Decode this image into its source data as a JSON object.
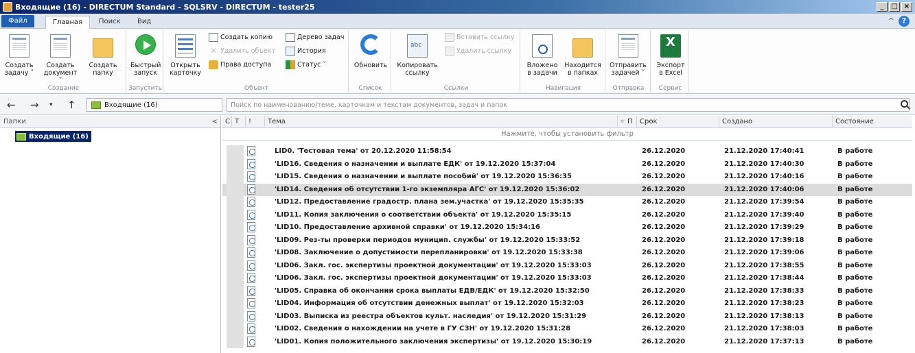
{
  "window": {
    "title": "Входящие (16) - DIRECTUM Standard - SQLSRV - DIRECTUM - tester25"
  },
  "tabs": {
    "file": "Файл",
    "home": "Главная",
    "search": "Поиск",
    "view": "Вид"
  },
  "ribbon": {
    "create": {
      "label": "Создание",
      "task": "Создать\nзадачу ˅",
      "document": "Создать\nдокумент ˅",
      "folder": "Создать\nпапку"
    },
    "run": {
      "label": "Запустить",
      "quick": "Быстрый\nзапуск"
    },
    "object": {
      "label": "Объект",
      "open_card": "Открыть\nкарточку",
      "create_copy": "Создать копию",
      "delete_object": "Удалить объект",
      "access_rights": "Права доступа",
      "task_tree": "Дерево задач",
      "history": "История",
      "status": "Статус ˅"
    },
    "list": {
      "label": "Список",
      "refresh": "Обновить"
    },
    "links": {
      "label": "Ссылки",
      "copy_link": "Копировать\nссылку",
      "paste_link": "Вставить ссылку",
      "delete_link": "Удалить ссылку"
    },
    "navigation": {
      "label": "Навигация",
      "nested": "Вложено\nв задачи",
      "located": "Находится\nв папках"
    },
    "send": {
      "label": "Отправка",
      "send_task": "Отправить\nзадачей ˅"
    },
    "service": {
      "label": "Сервис",
      "export_excel": "Экспорт\nв Excel"
    }
  },
  "address": {
    "crumb": "Входящие (16)",
    "search_placeholder": "Поиск по наименованию/теме, карточкам и текстам документов, задач и папок"
  },
  "folders": {
    "header": "Папки",
    "selected": "Входящие (16)"
  },
  "grid": {
    "columns": {
      "c": "С",
      "t": "Т",
      "imp": "!",
      "topic": "Тема",
      "p": "П",
      "due": "Срок",
      "created": "Создано",
      "state": "Состояние"
    },
    "filter_hint": "Нажмите, чтобы установить фильтр",
    "rows": [
      {
        "topic": "LID0. 'Тестовая тема' от 20.12.2020 11:58:54",
        "due": "26.12.2020",
        "created": "21.12.2020 17:40:41",
        "state": "В работе",
        "selected": false
      },
      {
        "topic": "'LID16. Сведения о назначении и выплате ЕДК' от 19.12.2020 15:37:04",
        "due": "26.12.2020",
        "created": "21.12.2020 17:40:30",
        "state": "В работе",
        "selected": false
      },
      {
        "topic": "'LID15. Сведения о назначении и выплате пособий' от 19.12.2020 15:36:35",
        "due": "26.12.2020",
        "created": "21.12.2020 17:40:16",
        "state": "В работе",
        "selected": false
      },
      {
        "topic": "'LID14. Сведения об отсутствии 1-го экземпляра АГС' от 19.12.2020 15:36:02",
        "due": "26.12.2020",
        "created": "21.12.2020 17:40:06",
        "state": "В работе",
        "selected": true
      },
      {
        "topic": "'LID12. Предоставление градостр. плана зем.участка' от 19.12.2020 15:35:35",
        "due": "26.12.2020",
        "created": "21.12.2020 17:39:54",
        "state": "В работе",
        "selected": false
      },
      {
        "topic": "'LID11. Копия заключения о соответствии объекта' от 19.12.2020 15:35:15",
        "due": "26.12.2020",
        "created": "21.12.2020 17:39:40",
        "state": "В работе",
        "selected": false
      },
      {
        "topic": "'LID10. Предоставление архивной справки' от 19.12.2020 15:34:16",
        "due": "26.12.2020",
        "created": "21.12.2020 17:39:29",
        "state": "В работе",
        "selected": false
      },
      {
        "topic": "'LID09. Рез-ты проверки периодов муницип. службы' от 19.12.2020 15:33:52",
        "due": "26.12.2020",
        "created": "21.12.2020 17:39:18",
        "state": "В работе",
        "selected": false
      },
      {
        "topic": "'LID08. Заключение о допустимости перепланировки' от 19.12.2020 15:33:38",
        "due": "26.12.2020",
        "created": "21.12.2020 17:39:06",
        "state": "В работе",
        "selected": false
      },
      {
        "topic": "'LID06. Закл. гос. экспертизы проектной документации' от 19.12.2020 15:33:03",
        "due": "26.12.2020",
        "created": "21.12.2020 17:38:55",
        "state": "В работе",
        "selected": false
      },
      {
        "topic": "'LID06. Закл. гос. экспертизы проектной документации' от 19.12.2020 15:33:03",
        "due": "26.12.2020",
        "created": "21.12.2020 17:38:44",
        "state": "В работе",
        "selected": false
      },
      {
        "topic": "'LID05. Справка об окончании срока выплаты ЕДВ/ЕДК' от 19.12.2020 15:32:50",
        "due": "26.12.2020",
        "created": "21.12.2020 17:38:33",
        "state": "В работе",
        "selected": false
      },
      {
        "topic": "'LID04. Информация об отсутствии денежных выплат' от 19.12.2020 15:32:03",
        "due": "26.12.2020",
        "created": "21.12.2020 17:38:23",
        "state": "В работе",
        "selected": false
      },
      {
        "topic": "'LID03. Выписка из реестра объектов культ. наследия' от 19.12.2020 15:31:29",
        "due": "26.12.2020",
        "created": "21.12.2020 17:38:13",
        "state": "В работе",
        "selected": false
      },
      {
        "topic": "'LID02. Сведения о нахождении на учете в ГУ СЗН' от 19.12.2020 15:31:28",
        "due": "26.12.2020",
        "created": "21.12.2020 17:38:03",
        "state": "В работе",
        "selected": false
      },
      {
        "topic": "'LID01. Копия положительного заключения экспертизы' от 19.12.2020 15:30:19",
        "due": "26.12.2020",
        "created": "21.12.2020 17:37:13",
        "state": "В работе",
        "selected": false
      }
    ]
  }
}
